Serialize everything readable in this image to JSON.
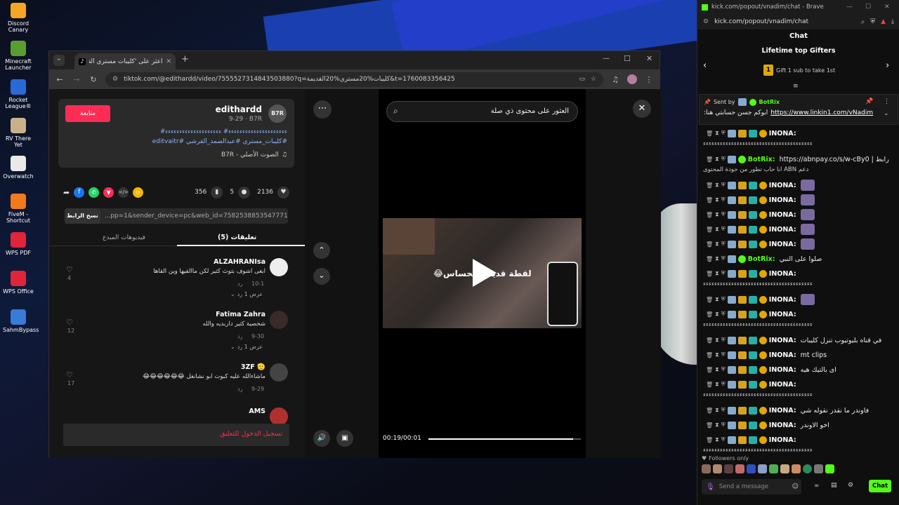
{
  "desktop": {
    "icons": [
      {
        "label": "Discord Canary",
        "color": "#f5a623"
      },
      {
        "label": "Minecraft Launcher",
        "color": "#5a9e31"
      },
      {
        "label": "Rocket League®",
        "color": "#2a6ad8"
      },
      {
        "label": "RV There Yet",
        "color": "#c9b28a"
      },
      {
        "label": "Overwatch",
        "color": "#e9e9e9"
      },
      {
        "label": "FiveM - Shortcut",
        "color": "#f07a1c"
      },
      {
        "label": "WPS PDF",
        "color": "#e0243a"
      },
      {
        "label": "WPS Office",
        "color": "#e0243a"
      },
      {
        "label": "SahmBypass",
        "color": "#3a7ad8"
      }
    ]
  },
  "browser": {
    "tab_title": "اعثر على 'كليبات مستري القديمة'",
    "url": "tiktok.com/@edithardd/video/7555527314843503880?q=كليبات%20مستري%20القديمة&t=1760083356425",
    "controls": {
      "minimize": "—",
      "maximize": "☐",
      "close": "✕",
      "new_tab": "+",
      "dropdown": "⌄"
    }
  },
  "tiktok": {
    "follow_label": "متابعة",
    "author": "edithardd",
    "author_sub": "9-29 · B7R",
    "avatar_text": "B7R",
    "caption_line1": "ءءءءءءءءءءءءءءءءءءءءء# ءءءءءءءءءءءءءءءءءءءء#",
    "caption_line2": "#كليبات_مستري #عبدالصمد_القرشي #editvaitr",
    "caption_line3": "ميستري_تاون#",
    "music": "الصوت الأصلي - B7R",
    "stats": {
      "likes": "2136",
      "comments": "5",
      "saves": "356"
    },
    "link_value": "...pp=1&sender_device=pc&web_id=7582538853547771410",
    "copy_link": "نسخ الرابط",
    "tabs": {
      "comments": "تعليقات (5)",
      "creator_videos": "فيديوهات المبدع"
    },
    "comments": [
      {
        "name": "ALZAHRANIsa",
        "text": "ابغى اشوف بثوث كثير لكن ماالقيها وين القاها",
        "date": "10-1",
        "reply": "رد",
        "likes": "4",
        "view_replies": "عرض 1 رد"
      },
      {
        "name": "Fatima Zahra",
        "text": "شخصية كثير داربديه والله",
        "date": "9-30",
        "reply": "رد",
        "likes": "12",
        "view_replies": "عرض 1 رد"
      },
      {
        "name": "3ZF 🫡",
        "text": "ماشاءالله عليه كبوت ابو نشانغل 😂😂😂😂😂😂",
        "date": "9-29",
        "reply": "رد",
        "likes": "17",
        "view_replies": ""
      },
      {
        "name": "AMS",
        "text": "",
        "date": "",
        "reply": "",
        "likes": "",
        "view_replies": ""
      }
    ],
    "login_prompt": "تسجيل الدخول للتعليق",
    "search_text": "العثور على محتوى ذي صلة",
    "video_time": "00:19/00:01",
    "video_overlay": "لقطة قديمة الحساس😂",
    "progress": 0.95
  },
  "chat": {
    "window_title": "kick.com/popout/vnadim/chat - Brave",
    "url": "kick.com/popout/vnadim/chat",
    "header": "Chat",
    "gifters_title": "Lifetime top Gifters",
    "gifters_sub": "Gift 1 sub to take 1st",
    "gift_rank": "1",
    "pinned_sent_by": "Sent by",
    "pinned_user": "BotRix",
    "pinned_text": "ابوكم جسن حسابتي هنا:",
    "pinned_link": "https://www.linkin1.com/vNadim",
    "messages": [
      {
        "user": "INONA:",
        "text": "",
        "emote": false
      },
      {
        "plain": "ءءءءءءءءءءءءءءءءءءءءءءءءءءءءءءءءءءءءءءء"
      },
      {
        "user": "BotRix:",
        "text": "https://abnpay.co/s/w-cBy0 | رابط",
        "emote": false,
        "bot": true
      },
      {
        "plain": "انا حاب تطور من جودة المحتوى ABN دعم"
      },
      {
        "user": "INONA:",
        "text": "",
        "emote": true
      },
      {
        "user": "INONA:",
        "text": "",
        "emote": true
      },
      {
        "user": "INONA:",
        "text": "",
        "emote": true
      },
      {
        "user": "INONA:",
        "text": "",
        "emote": true
      },
      {
        "user": "INONA:",
        "text": "",
        "emote": true
      },
      {
        "user": "BotRix:",
        "text": "صلوا على النبي",
        "emote": false,
        "bot": true
      },
      {
        "user": "INONA:",
        "text": "",
        "emote": false
      },
      {
        "plain": "ءءءءءءءءءءءءءءءءءءءءءءءءءءءءءءءءءءءءءءء"
      },
      {
        "user": "INONA:",
        "text": "",
        "emote": true
      },
      {
        "user": "INONA:",
        "text": "",
        "emote": false
      },
      {
        "plain": "ءءءءءءءءءءءءءءءءءءءءءءءءءءءءءءءءءءءءءءء"
      },
      {
        "user": "INONA:",
        "text": "في قناه بليوتيوب تنزل كليبات",
        "emote": false
      },
      {
        "user": "INONA:",
        "text": "mt clips",
        "emote": false
      },
      {
        "user": "INONA:",
        "text": "اى بالتيك هيه",
        "emote": false
      },
      {
        "user": "INONA:",
        "text": "",
        "emote": false
      },
      {
        "plain": "ءءءءءءءءءءءءءءءءءءءءءءءءءءءءءءءءءءءءءءء"
      },
      {
        "user": "INONA:",
        "text": "فاوندر ما نقدر نقوله شي",
        "emote": false
      },
      {
        "user": "INONA:",
        "text": "اخو الاوندر",
        "emote": false
      },
      {
        "user": "INONA:",
        "text": "",
        "emote": false
      },
      {
        "plain": "ءءءءءءءءءءءءءءءءءءءءءءءءءءءءءءءءءءءءءءء"
      }
    ],
    "followers_only": "Followers only",
    "input_placeholder": "Send a message",
    "send_label": "Chat"
  }
}
